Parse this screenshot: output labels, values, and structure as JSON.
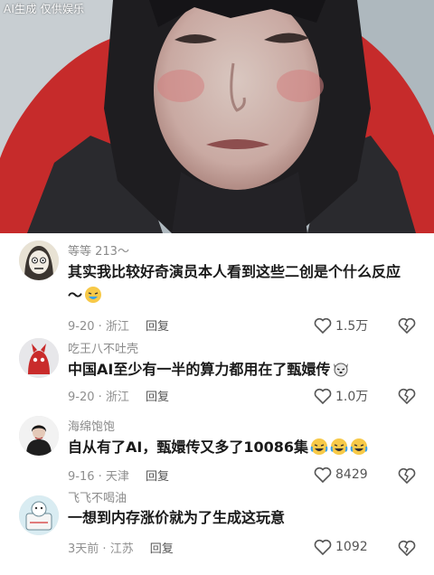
{
  "watermark": "AI生成 仅供娱乐",
  "comments": [
    {
      "user": "等等 213～",
      "text": "其实我比较好奇演员本人看到这些二创是个什么反应～",
      "date": "9-20",
      "location": "浙江",
      "reply_label": "回复",
      "likes": "1.5万",
      "emojis": [
        "laugh-emoji"
      ]
    },
    {
      "user": "吃王八不吐壳",
      "text": "中国AI至少有一半的算力都用在了甄嬛传",
      "date": "9-20",
      "location": "浙江",
      "reply_label": "回复",
      "likes": "1.0万",
      "emojis": [
        "dog-emoji"
      ]
    },
    {
      "user": "海绵饱饱",
      "text": "自从有了AI，甄嬛传又多了10086集",
      "date": "9-16",
      "location": "天津",
      "reply_label": "回复",
      "likes": "8429",
      "emojis": [
        "crying-laugh-emoji",
        "crying-laugh-emoji",
        "crying-laugh-emoji"
      ]
    },
    {
      "user": "飞飞不喝油",
      "text": "一想到内存涨价就为了生成这玩意",
      "date": "3天前",
      "location": "江苏",
      "reply_label": "回复",
      "likes": "1092",
      "emojis": []
    }
  ],
  "colors": {
    "username": "#8a8a8a",
    "text": "#1a1a1a",
    "meta": "#8f8f8f",
    "jacket": "#c62b2b"
  }
}
